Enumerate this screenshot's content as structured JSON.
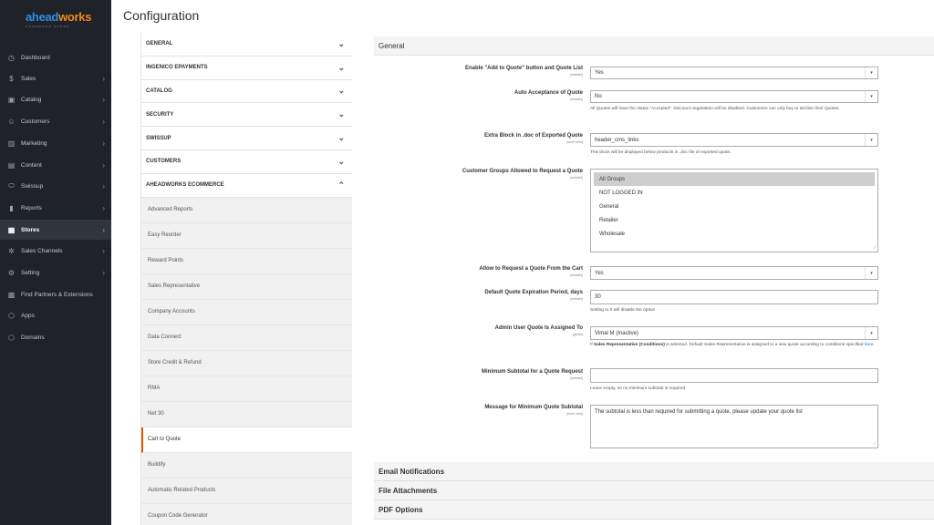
{
  "brand": {
    "logo_main_a": "ahead",
    "logo_main_b": "works",
    "logo_sub": "COMMERCE STORE"
  },
  "sidebar": {
    "items": [
      {
        "label": "Dashboard",
        "icon": "dashboard-icon",
        "glyph": "◷"
      },
      {
        "label": "Sales",
        "icon": "dollar-icon",
        "glyph": "$",
        "chev": "›"
      },
      {
        "label": "Catalog",
        "icon": "catalog-icon",
        "glyph": "▣",
        "chev": "›"
      },
      {
        "label": "Customers",
        "icon": "customers-icon",
        "glyph": "☺",
        "chev": "›"
      },
      {
        "label": "Marketing",
        "icon": "marketing-icon",
        "glyph": "▥",
        "chev": "›"
      },
      {
        "label": "Content",
        "icon": "content-icon",
        "glyph": "▤",
        "chev": "›"
      },
      {
        "label": "Swissup",
        "icon": "swissup-icon",
        "glyph": "⬭",
        "chev": "›"
      },
      {
        "label": "Reports",
        "icon": "reports-icon",
        "glyph": "▮",
        "chev": "›"
      },
      {
        "label": "Stores",
        "icon": "stores-icon",
        "glyph": "▦",
        "chev": "›"
      },
      {
        "label": "Sales Channels",
        "icon": "sales-channels-icon",
        "glyph": "✲",
        "chev": "›"
      },
      {
        "label": "Setting",
        "icon": "gear-icon",
        "glyph": "⚙",
        "chev": "›"
      },
      {
        "label": "Find Partners & Extensions",
        "icon": "partners-icon",
        "glyph": "▩"
      },
      {
        "label": "Apps",
        "icon": "apps-icon",
        "glyph": "⬡"
      },
      {
        "label": "Domains",
        "icon": "domains-icon",
        "glyph": "⬡"
      }
    ]
  },
  "page": {
    "title": "Configuration"
  },
  "tabs": {
    "sections": [
      "GENERAL",
      "INGENICO EPAYMENTS",
      "CATALOG",
      "SECURITY",
      "SWISSUP",
      "CUSTOMERS",
      "AHEADWORKS ECOMMERCE"
    ],
    "caret_down": "⌄",
    "caret_up": "⌃",
    "subitems": [
      "Advanced Reports",
      "Easy Reorder",
      "Reward Points",
      "Sales Representative",
      "Company Accounts",
      "Data Connect",
      "Store Credit & Refund",
      "RMA",
      "Net 30",
      "Cart to Quote",
      "Buildify",
      "Automatic Related Products",
      "Coupon Code Generator"
    ]
  },
  "form": {
    "section_title": "General",
    "enable_label": "Enable \"Add to Quote\" button and Quote List",
    "enable_scope": "[website]",
    "enable_value": "Yes",
    "auto_label": "Auto Acceptance of Quote",
    "auto_scope": "[website]",
    "auto_value": "No",
    "auto_note": "All Quotes will have the status \"Accepted\". Discount negotiation will be disabled. Customers can only buy or decline their Quotes.",
    "extra_label": "Extra Block in .doc of Exported Quote",
    "extra_scope": "[store view]",
    "extra_value": "header_cms_links",
    "extra_note": "This block will be displayed below products in .doc file of exported quote.",
    "groups_label": "Customer Groups Allowed to Request a Quote",
    "groups_scope": "[website]",
    "groups_options": [
      "All Groups",
      "NOT LOGGED IN",
      "General",
      "Retailer",
      "Wholesale"
    ],
    "cart_label": "Allow to Request a Quote From the Cart",
    "cart_scope": "[website]",
    "cart_value": "Yes",
    "exp_label": "Default Quote Expiration Period, days",
    "exp_scope": "[website]",
    "exp_value": "30",
    "exp_note": "Setting to 0 will disable the option",
    "admin_label": "Admin User Quote Is Assigned To",
    "admin_scope": "[global]",
    "admin_value": "Vimal M (Inactive)",
    "admin_note_pre": "If ",
    "admin_note_bold": "Sales Representative (Conditions)",
    "admin_note_mid": " is selected. Default Sales Representative is assigned to a new quote according to conditions specified ",
    "admin_note_link": "here",
    "admin_note_end": ".",
    "min_label": "Minimum Subtotal for a Quote Request",
    "min_scope": "[website]",
    "min_value": "",
    "min_note": "Leave empty, so no minimum subtotal is required",
    "msg_label": "Message for Minimum Quote Subtotal",
    "msg_scope": "[store view]",
    "msg_value": "The subtotal is less than required for submitting a quote, please update your quote list",
    "select_arrow": "▾",
    "grip": "⟋"
  },
  "collapsed_sections": [
    "Email Notifications",
    "File Attachments",
    "PDF Options"
  ]
}
